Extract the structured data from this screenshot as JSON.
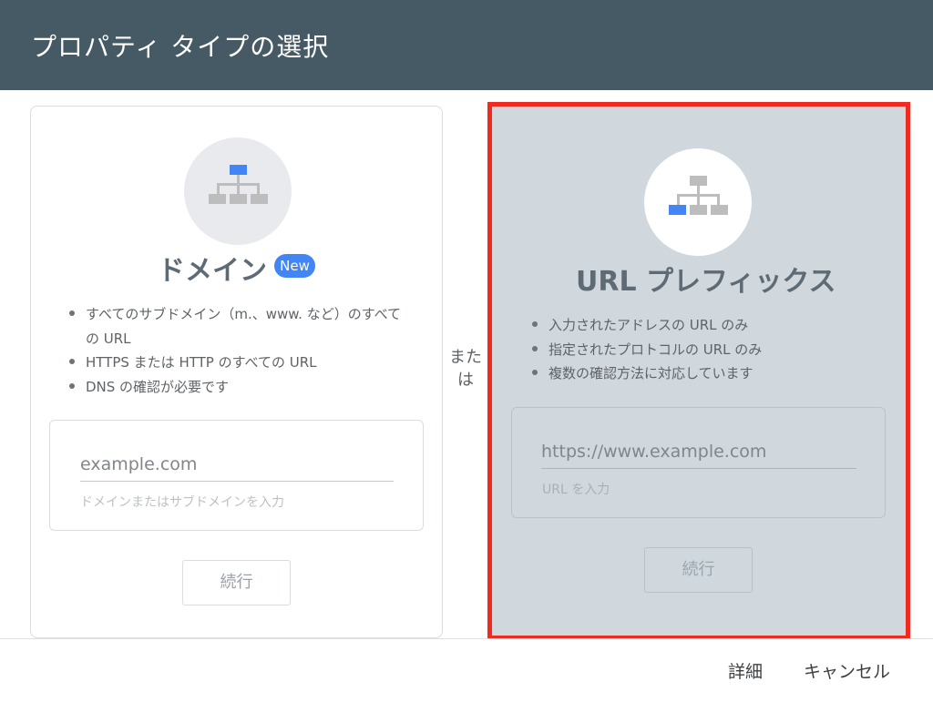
{
  "header": {
    "title": "プロパティ タイプの選択"
  },
  "domain_card": {
    "icon": "sitemap-root-icon",
    "title": "ドメイン",
    "badge": "New",
    "bullets": [
      "すべてのサブドメイン（m.、www. など）のすべての URL",
      "HTTPS または HTTP のすべての URL",
      "DNS の確認が必要です"
    ],
    "input": {
      "placeholder": "example.com",
      "value": "",
      "hint": "ドメインまたはサブドメインを入力"
    },
    "continue_label": "続行"
  },
  "separator": {
    "text": "または"
  },
  "url_card": {
    "icon": "sitemap-leaf-icon",
    "title": "URL プレフィックス",
    "bullets": [
      "入力されたアドレスの URL のみ",
      "指定されたプロトコルの URL のみ",
      "複数の確認方法に対応しています"
    ],
    "input": {
      "placeholder": "https://www.example.com",
      "value": "",
      "hint": "URL を入力"
    },
    "continue_label": "続行"
  },
  "footer": {
    "details_label": "詳細",
    "cancel_label": "キャンセル"
  },
  "colors": {
    "header_bg": "#455a64",
    "selected_card_bg": "#d0d8dd",
    "selection_outline": "#ee2a21",
    "accent_blue": "#4285f4",
    "icon_gray": "#bdbdbd"
  }
}
